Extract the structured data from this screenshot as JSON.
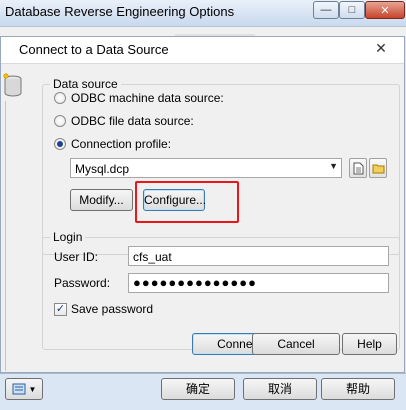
{
  "outer_window": {
    "title": "Database Reverse Engineering Options",
    "min_glyph": "—",
    "max_glyph": "□",
    "close_glyph": "✕"
  },
  "dialog": {
    "title": "Connect to a Data Source",
    "close_glyph": "✕",
    "data_source": {
      "legend": "Data source",
      "options": [
        {
          "label": "ODBC machine data source:",
          "selected": false
        },
        {
          "label": "ODBC file data source:",
          "selected": false
        },
        {
          "label": "Connection profile:",
          "selected": true
        }
      ],
      "profile_value": "Mysql.dcp",
      "modify_label": "Modify...",
      "configure_label": "Configure..."
    },
    "login": {
      "legend": "Login",
      "user_id_label": "User ID:",
      "user_id_value": "cfs_uat",
      "password_label": "Password:",
      "password_value": "●●●●●●●●●●●●●●",
      "save_password_label": "Save password",
      "save_password_checked": true
    },
    "buttons": {
      "connect": "Connect",
      "cancel": "Cancel",
      "help": "Help"
    }
  },
  "bottom_bar": {
    "ok": "确定",
    "cancel": "取消",
    "help": "帮助"
  },
  "colors": {
    "highlight": "#e8181a",
    "default_button_border": "#3d7bad",
    "title_bar_gradient": "#c9d9ee"
  }
}
